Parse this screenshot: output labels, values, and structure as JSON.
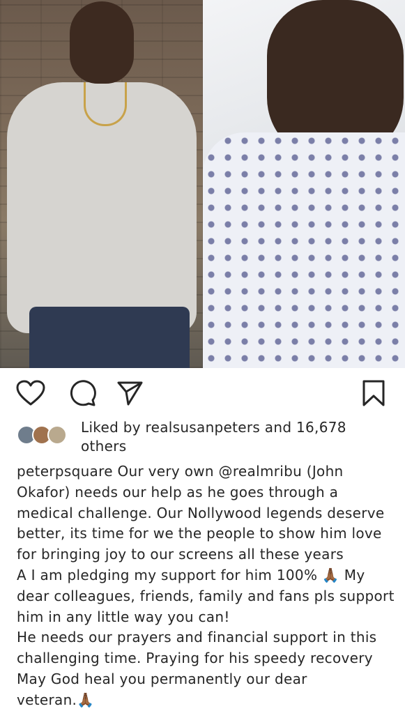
{
  "post": {
    "images": [
      {
        "alt": "Man in grey t-shirt with gold chain standing outdoors",
        "icon": "photo-standing"
      },
      {
        "alt": "Man lying in hospital bed wearing patterned gown",
        "icon": "photo-hospital"
      }
    ]
  },
  "actions": {
    "like_icon": "heart-icon",
    "comment_icon": "comment-icon",
    "share_icon": "share-icon",
    "save_icon": "bookmark-icon"
  },
  "likes": {
    "line1": "Liked by realsusanpeters and 16,678",
    "line2": "others"
  },
  "caption": {
    "lines": [
      "peterpsquare Our very own @realmribu (John",
      "Okafor) needs our help as he goes through a",
      "medical challenge. Our Nollywood legends deserve",
      "better, its time for we the people to show him love",
      "for bringing joy to our screens all these years",
      "A I am pledging my support for him 100% 🙏🏾 My",
      "dear colleagues, friends, family and fans pls support",
      "him in any  little way you can!",
      "He needs our prayers and financial support in this",
      "challenging time. Praying for his speedy recovery",
      "May God heal you permanently our dear",
      "veteran.🙏🏾"
    ]
  },
  "colors": {
    "text": "#262626",
    "background": "#ffffff"
  }
}
